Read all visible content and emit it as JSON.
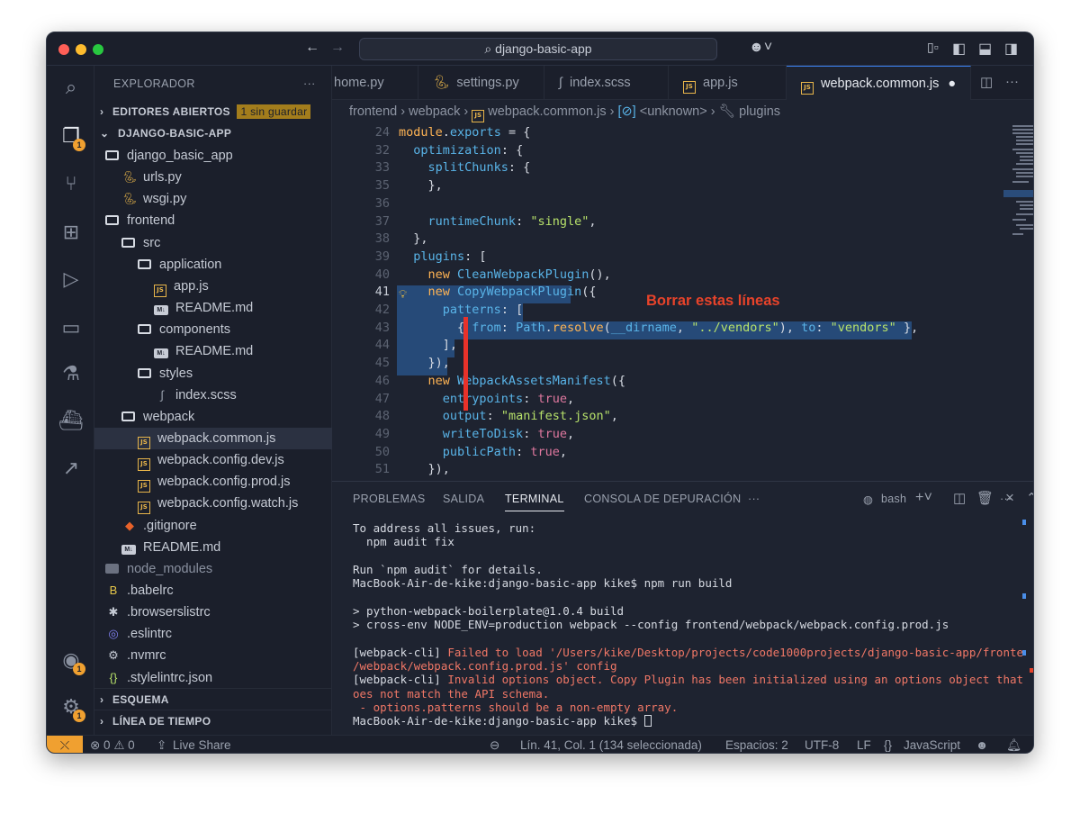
{
  "title_bar": {
    "search_text": "django-basic-app",
    "traffic_lights": {
      "close": "#ff5f57",
      "minimize": "#febc2e",
      "zoom": "#28c840"
    }
  },
  "activity_bar": {
    "badges": {
      "explorer": "1",
      "accounts": "1",
      "settings": "1"
    }
  },
  "sidebar": {
    "title": "EXPLORADOR",
    "more": "···",
    "open_editors": "EDITORES ABIERTOS",
    "unsaved_badge": "1 sin guardar",
    "project": "DJANGO-BASIC-APP",
    "tree": [
      {
        "label": "django_basic_app",
        "kind": "folder",
        "depth": 1
      },
      {
        "label": "urls.py",
        "kind": "py",
        "depth": 2
      },
      {
        "label": "wsgi.py",
        "kind": "py",
        "depth": 2
      },
      {
        "label": "frontend",
        "kind": "folder",
        "depth": 1
      },
      {
        "label": "src",
        "kind": "folder",
        "depth": 2
      },
      {
        "label": "application",
        "kind": "folder",
        "depth": 3
      },
      {
        "label": "app.js",
        "kind": "js",
        "depth": 4
      },
      {
        "label": "README.md",
        "kind": "md",
        "depth": 4
      },
      {
        "label": "components",
        "kind": "folder",
        "depth": 3
      },
      {
        "label": "README.md",
        "kind": "md",
        "depth": 4
      },
      {
        "label": "styles",
        "kind": "folder",
        "depth": 3
      },
      {
        "label": "index.scss",
        "kind": "scss",
        "depth": 4
      },
      {
        "label": "webpack",
        "kind": "folder",
        "depth": 2
      },
      {
        "label": "webpack.common.js",
        "kind": "js",
        "depth": 3,
        "selected": true
      },
      {
        "label": "webpack.config.dev.js",
        "kind": "js",
        "depth": 3
      },
      {
        "label": "webpack.config.prod.js",
        "kind": "js",
        "depth": 3
      },
      {
        "label": "webpack.config.watch.js",
        "kind": "js",
        "depth": 3
      },
      {
        "label": ".gitignore",
        "kind": "git",
        "depth": 2
      },
      {
        "label": "README.md",
        "kind": "md",
        "depth": 2
      },
      {
        "label": "node_modules",
        "kind": "folder-grey",
        "depth": 1
      },
      {
        "label": ".babelrc",
        "kind": "babel",
        "depth": 1
      },
      {
        "label": ".browserslistrc",
        "kind": "star",
        "depth": 1
      },
      {
        "label": ".eslintrc",
        "kind": "eslint",
        "depth": 1
      },
      {
        "label": ".nvmrc",
        "kind": "gear",
        "depth": 1
      },
      {
        "label": ".stylelintrc.json",
        "kind": "json",
        "depth": 1
      }
    ],
    "outline": "ESQUEMA",
    "timeline": "LÍNEA DE TIEMPO"
  },
  "tabs": [
    {
      "label": "home.py",
      "kind": "py"
    },
    {
      "label": "settings.py",
      "kind": "py"
    },
    {
      "label": "index.scss",
      "kind": "scss"
    },
    {
      "label": "app.js",
      "kind": "js"
    },
    {
      "label": "webpack.common.js",
      "kind": "js",
      "active": true,
      "dirty": true
    }
  ],
  "breadcrumb": [
    "frontend",
    "webpack",
    "webpack.common.js",
    "<unknown>",
    "plugins"
  ],
  "editor": {
    "current_line": "41",
    "selection_note": "Borrar estas líneas",
    "lines": [
      {
        "n": "24",
        "tokens": [
          [
            "k",
            "module"
          ],
          [
            "p",
            "."
          ],
          [
            "f",
            "exports"
          ],
          [
            "p",
            " = {"
          ]
        ]
      },
      {
        "n": "32",
        "tokens": [
          [
            "p",
            "  "
          ],
          [
            "f",
            "optimization"
          ],
          [
            "p",
            ": {"
          ]
        ]
      },
      {
        "n": "33",
        "tokens": [
          [
            "p",
            "    "
          ],
          [
            "f",
            "splitChunks"
          ],
          [
            "p",
            ": {"
          ]
        ]
      },
      {
        "n": "35",
        "tokens": [
          [
            "p",
            "    },"
          ]
        ]
      },
      {
        "n": "36",
        "tokens": []
      },
      {
        "n": "37",
        "tokens": [
          [
            "p",
            "    "
          ],
          [
            "f",
            "runtimeChunk"
          ],
          [
            "p",
            ": "
          ],
          [
            "s",
            "\"single\""
          ],
          [
            "p",
            ","
          ]
        ]
      },
      {
        "n": "38",
        "tokens": [
          [
            "p",
            "  },"
          ]
        ]
      },
      {
        "n": "39",
        "tokens": [
          [
            "p",
            "  "
          ],
          [
            "f",
            "plugins"
          ],
          [
            "p",
            ": ["
          ]
        ]
      },
      {
        "n": "40",
        "tokens": [
          [
            "p",
            "    "
          ],
          [
            "k",
            "new "
          ],
          [
            "f",
            "CleanWebpackPlugin"
          ],
          [
            "p",
            "(),"
          ]
        ]
      },
      {
        "n": "41",
        "tokens": [
          [
            "p",
            "    "
          ],
          [
            "k",
            "new "
          ],
          [
            "f",
            "CopyWebpackPlugin"
          ],
          [
            "p",
            "({"
          ]
        ]
      },
      {
        "n": "42",
        "tokens": [
          [
            "p",
            "      "
          ],
          [
            "f",
            "patterns"
          ],
          [
            "p",
            ": ["
          ]
        ]
      },
      {
        "n": "43",
        "tokens": [
          [
            "p",
            "        { "
          ],
          [
            "f",
            "from"
          ],
          [
            "p",
            ": "
          ],
          [
            "f",
            "Path"
          ],
          [
            "p",
            "."
          ],
          [
            "k",
            "resolve"
          ],
          [
            "p",
            "("
          ],
          [
            "f",
            "__dirname"
          ],
          [
            "p",
            ", "
          ],
          [
            "s",
            "\"../vendors\""
          ],
          [
            "p",
            "), "
          ],
          [
            "f",
            "to"
          ],
          [
            "p",
            ": "
          ],
          [
            "s",
            "\"vendors\""
          ],
          [
            "p",
            " },"
          ]
        ]
      },
      {
        "n": "44",
        "tokens": [
          [
            "p",
            "      ],"
          ]
        ]
      },
      {
        "n": "45",
        "tokens": [
          [
            "p",
            "    }),"
          ]
        ]
      },
      {
        "n": "46",
        "tokens": [
          [
            "p",
            "    "
          ],
          [
            "k",
            "new "
          ],
          [
            "f",
            "WebpackAssetsManifest"
          ],
          [
            "p",
            "({"
          ]
        ]
      },
      {
        "n": "47",
        "tokens": [
          [
            "p",
            "      "
          ],
          [
            "f",
            "entrypoints"
          ],
          [
            "p",
            ": "
          ],
          [
            "o",
            "true"
          ],
          [
            "p",
            ","
          ]
        ]
      },
      {
        "n": "48",
        "tokens": [
          [
            "p",
            "      "
          ],
          [
            "f",
            "output"
          ],
          [
            "p",
            ": "
          ],
          [
            "s",
            "\"manifest.json\""
          ],
          [
            "p",
            ","
          ]
        ]
      },
      {
        "n": "49",
        "tokens": [
          [
            "p",
            "      "
          ],
          [
            "f",
            "writeToDisk"
          ],
          [
            "p",
            ": "
          ],
          [
            "o",
            "true"
          ],
          [
            "p",
            ","
          ]
        ]
      },
      {
        "n": "50",
        "tokens": [
          [
            "p",
            "      "
          ],
          [
            "f",
            "publicPath"
          ],
          [
            "p",
            ": "
          ],
          [
            "o",
            "true"
          ],
          [
            "p",
            ","
          ]
        ]
      },
      {
        "n": "51",
        "tokens": [
          [
            "p",
            "    }),"
          ]
        ]
      }
    ]
  },
  "panel": {
    "tabs": [
      "PROBLEMAS",
      "SALIDA",
      "TERMINAL",
      "CONSOLA DE DEPURACIÓN"
    ],
    "active_tab": "TERMINAL",
    "shell": "bash",
    "terminal_lines": [
      {
        "text": "To address all issues, run:",
        "kind": "normal"
      },
      {
        "text": "  npm audit fix",
        "kind": "normal"
      },
      {
        "text": "",
        "kind": "normal"
      },
      {
        "text": "Run `npm audit` for details.",
        "kind": "normal"
      },
      {
        "text": "MacBook-Air-de-kike:django-basic-app kike$ npm run build",
        "kind": "prompt-error"
      },
      {
        "text": "",
        "kind": "normal"
      },
      {
        "text": "> python-webpack-boilerplate@1.0.4 build",
        "kind": "normal"
      },
      {
        "text": "> cross-env NODE_ENV=production webpack --config frontend/webpack/webpack.config.prod.js",
        "kind": "normal"
      },
      {
        "text": "",
        "kind": "normal"
      },
      {
        "text": "[webpack-cli] ",
        "kind": "error-prefix",
        "rest": "Failed to load '/Users/kike/Desktop/projects/code1000projects/django-basic-app/frontend"
      },
      {
        "text": "",
        "kind": "error",
        "rest": "/webpack/webpack.config.prod.js' config"
      },
      {
        "text": "[webpack-cli] ",
        "kind": "error-prefix",
        "rest": "Invalid options object. Copy Plugin has been initialized using an options object that d"
      },
      {
        "text": "",
        "kind": "error",
        "rest": "oes not match the API schema."
      },
      {
        "text": "",
        "kind": "error",
        "rest": " - options.patterns should be a non-empty array."
      },
      {
        "text": "MacBook-Air-de-kike:django-basic-app kike$ ",
        "kind": "prompt-current"
      }
    ]
  },
  "status_bar": {
    "problems": "⊗ 0 ⚠ 0",
    "live_share": "Live Share",
    "position": "Lín. 41, Col. 1 (134 seleccionada)",
    "spaces": "Espacios: 2",
    "encoding": "UTF-8",
    "eol": "LF",
    "language": "JavaScript"
  }
}
